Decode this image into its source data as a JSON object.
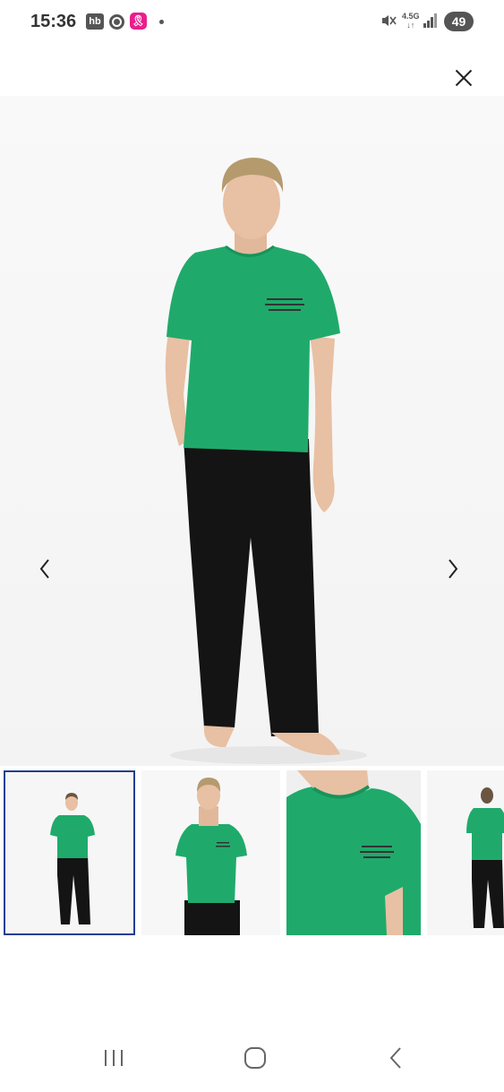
{
  "status_bar": {
    "time": "15:36",
    "app_badge": "hb",
    "ribbon_glyph": "🎗",
    "network_label": "4.5G",
    "battery": "49"
  },
  "icons": {
    "close": "close-icon",
    "prev": "chevron-left-icon",
    "next": "chevron-right-icon",
    "recents": "recent-apps-icon",
    "home": "home-icon",
    "back": "back-icon"
  },
  "colors": {
    "shirt": "#1faa6b",
    "pants": "#141414",
    "skin": "#e8c0a3",
    "hair": "#b59a6e",
    "selected_border": "#1e3f8f"
  },
  "thumbnails": [
    {
      "view": "front-full",
      "selected": true
    },
    {
      "view": "front-upper",
      "selected": false
    },
    {
      "view": "chest-closeup",
      "selected": false
    },
    {
      "view": "back-full",
      "selected": false
    }
  ]
}
